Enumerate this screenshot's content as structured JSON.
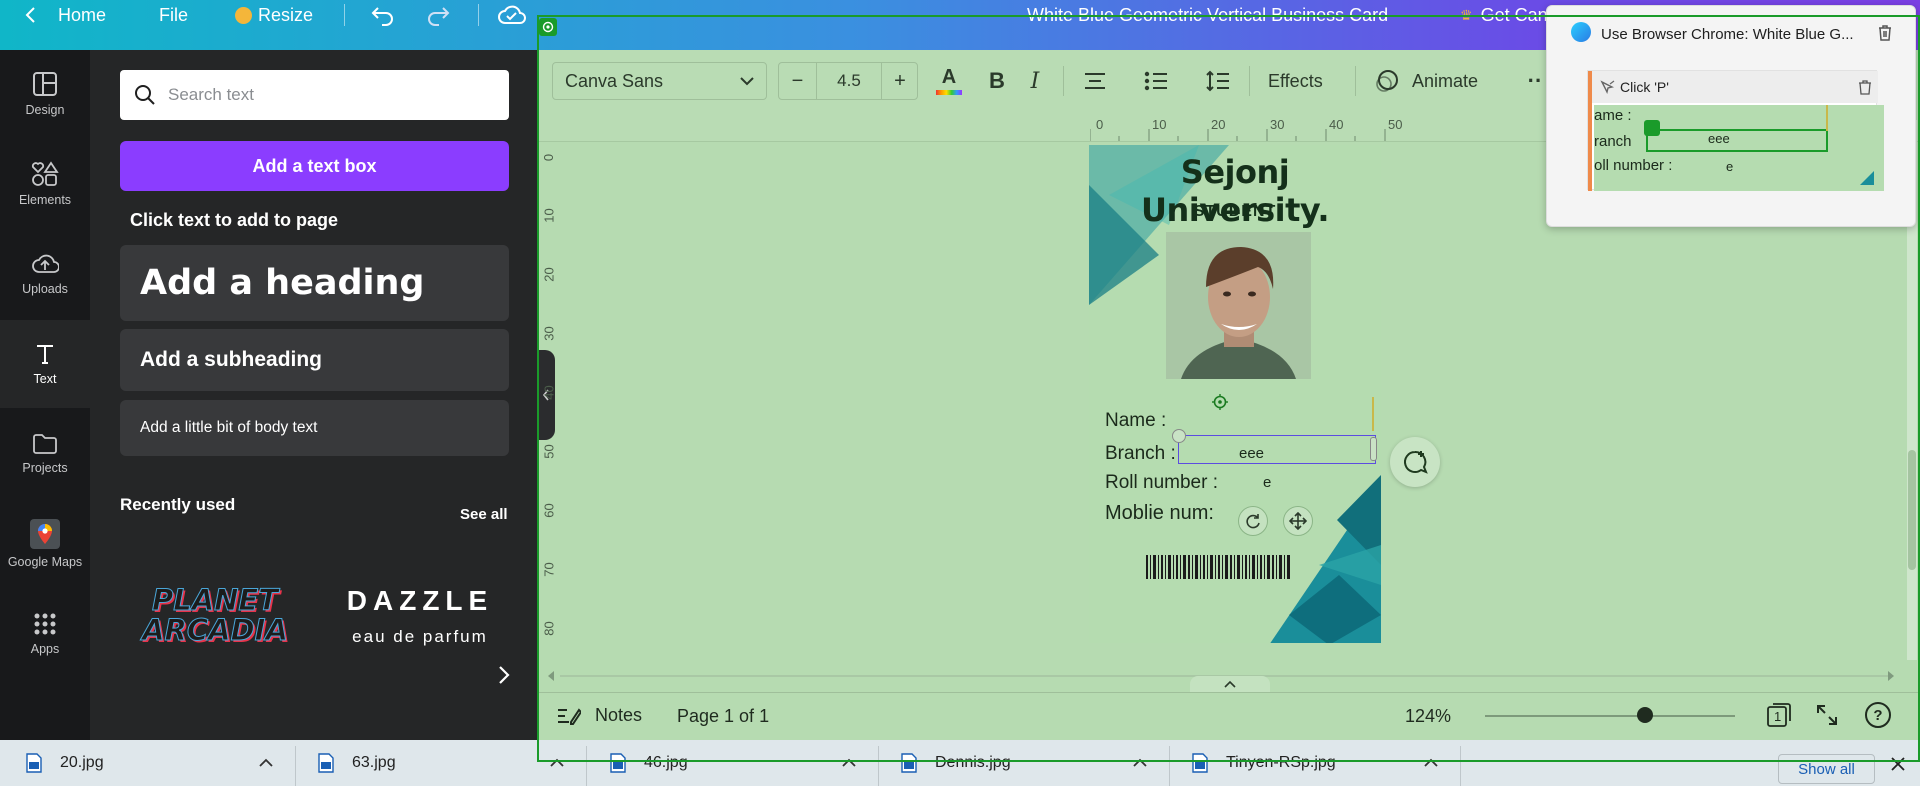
{
  "topbar": {
    "home": "Home",
    "file": "File",
    "resize": "Resize",
    "doc_title": "White Blue Geometric Vertical Business Card",
    "get_canva": "Get Can"
  },
  "rail": [
    {
      "label": "Design",
      "icon": "design-icon"
    },
    {
      "label": "Elements",
      "icon": "elements-icon"
    },
    {
      "label": "Uploads",
      "icon": "uploads-icon"
    },
    {
      "label": "Text",
      "icon": "text-icon"
    },
    {
      "label": "Projects",
      "icon": "projects-icon"
    },
    {
      "label": "Google Maps",
      "icon": "google-maps-icon"
    },
    {
      "label": "Apps",
      "icon": "apps-icon"
    }
  ],
  "panel": {
    "search_placeholder": "Search text",
    "add_text_box": "Add a text box",
    "click_text": "Click text to add to page",
    "heading": "Add a heading",
    "subheading": "Add a subheading",
    "body": "Add a little bit of body text",
    "recently_used": "Recently used",
    "see_all": "See all",
    "font1": "PLANET ARCADIA",
    "font2_title": "DAZZLE",
    "font2_sub": "eau de parfum"
  },
  "toolbar": {
    "font": "Canva Sans",
    "size": "4.5",
    "effects": "Effects",
    "animate": "Animate"
  },
  "ruler_top": [
    "0",
    "10",
    "20",
    "30",
    "40",
    "50"
  ],
  "ruler_left": [
    "0",
    "10",
    "20",
    "30",
    "40",
    "50",
    "60",
    "70",
    "80"
  ],
  "card": {
    "title": "Sejonj University.",
    "subtitle": "STUDENT",
    "name_label": "Name  :",
    "branch_label": "Branch :",
    "branch_value": "eee",
    "roll_label": "Roll  number :",
    "roll_value": "e",
    "mobile_label": "Moblie num:"
  },
  "bottombar": {
    "notes": "Notes",
    "page": "Page 1 of 1",
    "zoom": "124%",
    "zoom_fraction": 0.64,
    "page_count": "1"
  },
  "popup": {
    "title": "Use Browser Chrome: White Blue G...",
    "step": "Click 'P'",
    "mini_name": "ame  :",
    "mini_branch": "ranch",
    "mini_branch_value": "eee",
    "mini_roll": "oll  number :",
    "mini_roll_value": "e"
  },
  "downloads": {
    "files": [
      "20.jpg",
      "63.jpg",
      "46.jpg",
      "Dennis.jpg",
      "Tinyen-RSp.jpg"
    ],
    "show_all": "Show all"
  },
  "colors": {
    "accent_purple": "#8b3dff",
    "canvas_green": "#b6dbb1",
    "card_teal": "#1a8e9a",
    "selection_green": "#1a9b2a"
  }
}
